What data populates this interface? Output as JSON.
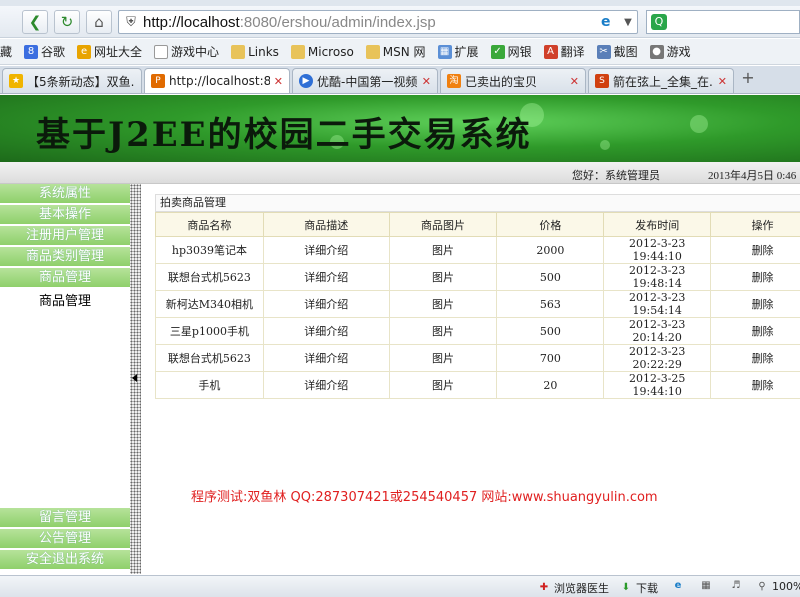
{
  "browser": {
    "url_host": "http://localhost",
    "url_rest": ":8080/ershou/admin/index.jsp",
    "search_placeholder": "",
    "bookmarks": [
      "藏",
      "谷歌",
      "网址大全",
      "游戏中心",
      "Links",
      "Microso",
      "MSN 网",
      "扩展",
      "网银",
      "翻译",
      "截图",
      "游戏"
    ],
    "tabs": [
      {
        "label": "【5条新动态】双鱼...",
        "active": false
      },
      {
        "label": "http://localhost:8...",
        "active": true
      },
      {
        "label": "优酷-中国第一视频...",
        "active": false
      },
      {
        "label": "已卖出的宝贝",
        "active": false
      },
      {
        "label": "箭在弦上_全集_在...",
        "active": false
      }
    ]
  },
  "header": {
    "title": "基于J2EE的校园二手交易系统",
    "greeting": "您好：系统管理员",
    "date": "2013年4月5日 0:46"
  },
  "sidebar": {
    "top_items": [
      "系统属性",
      "基本操作",
      "注册用户管理",
      "商品类别管理",
      "商品管理"
    ],
    "sub_item": "商品管理",
    "bottom_items": [
      "留言管理",
      "公告管理",
      "安全退出系统"
    ]
  },
  "main": {
    "panel_title": "拍卖商品管理",
    "columns": [
      "商品名称",
      "商品描述",
      "商品图片",
      "价格",
      "发布时间",
      "操作"
    ],
    "rows": [
      {
        "name": "hp3039笔记本",
        "desc": "详细介绍",
        "img": "图片",
        "price": "2000",
        "time": "2012-3-23 19:44:10",
        "op": "删除"
      },
      {
        "name": "联想台式机5623",
        "desc": "详细介绍",
        "img": "图片",
        "price": "500",
        "time": "2012-3-23 19:48:14",
        "op": "删除"
      },
      {
        "name": "新柯达M340相机",
        "desc": "详细介绍",
        "img": "图片",
        "price": "563",
        "time": "2012-3-23 19:54:14",
        "op": "删除"
      },
      {
        "name": "三星p1000手机",
        "desc": "详细介绍",
        "img": "图片",
        "price": "500",
        "time": "2012-3-23 20:14:20",
        "op": "删除"
      },
      {
        "name": "联想台式机5623",
        "desc": "详细介绍",
        "img": "图片",
        "price": "700",
        "time": "2012-3-23 20:22:29",
        "op": "删除"
      },
      {
        "name": "手机",
        "desc": "详细介绍",
        "img": "图片",
        "price": "20",
        "time": "2012-3-25 19:44:10",
        "op": "删除"
      }
    ],
    "credit": "程序测试:双鱼林 QQ:287307421或254540457 网站:www.shuangyulin.com"
  },
  "statusbar": {
    "doctor": "浏览器医生",
    "download": "下载",
    "zoom": "100%"
  },
  "colors": {
    "sidebar_green": "#8fd06b",
    "banner_green": "#2f9a2a",
    "credit_red": "#e02020"
  }
}
